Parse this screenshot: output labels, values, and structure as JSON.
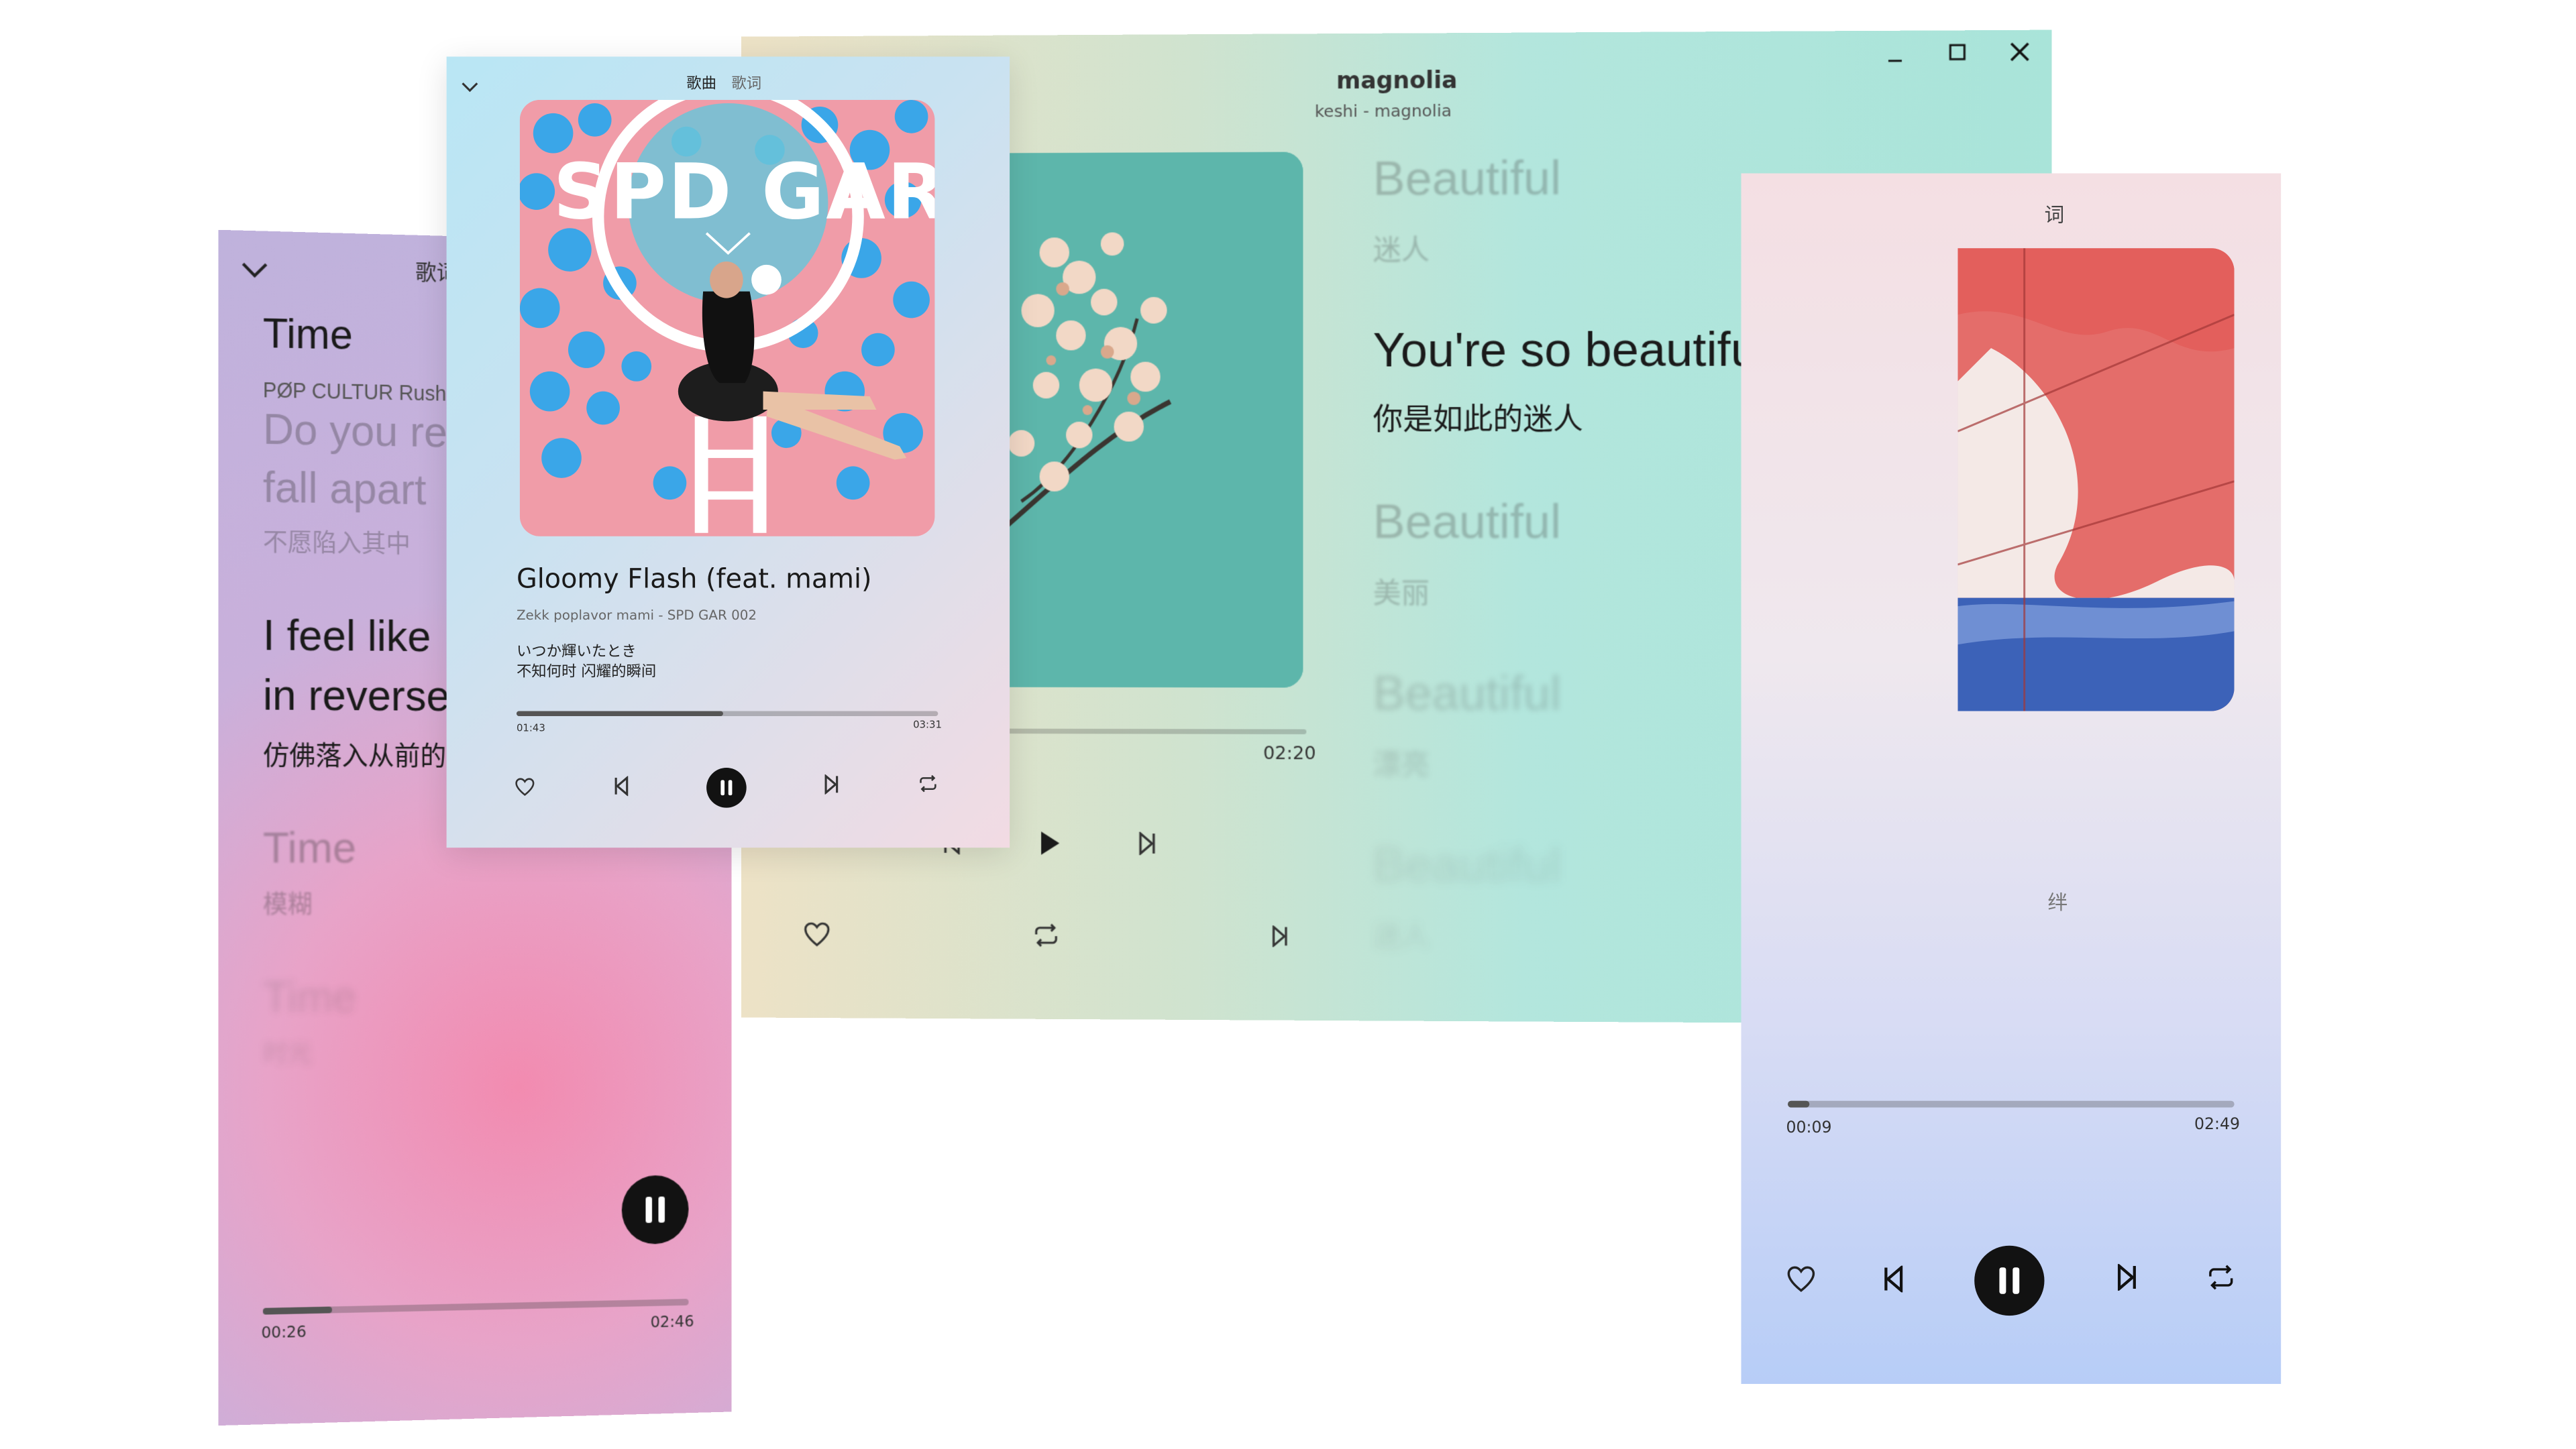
{
  "left": {
    "tab_label": "歌词",
    "title": "Time",
    "artist": "PØP CULTUR  Rush",
    "lyrics": [
      {
        "text": "Do you re"
      },
      {
        "text": "fall apart"
      },
      {
        "text": "不愿陷入其中"
      },
      {
        "text": "I feel like"
      },
      {
        "text": "in reverse"
      },
      {
        "text": "仿佛落入从前的"
      },
      {
        "text": "Time"
      },
      {
        "text": "模糊"
      },
      {
        "text": "Time"
      },
      {
        "text": "时光"
      }
    ],
    "elapsed": "00:26",
    "total": "02:46",
    "progress": 0.16
  },
  "center": {
    "title": "magnolia",
    "subtitle": "keshi  -  magnolia",
    "lyrics": [
      {
        "en": "Beautiful",
        "zh": "迷人"
      },
      {
        "en": "You're so beautiful",
        "zh": "你是如此的迷人"
      },
      {
        "en": "Beautiful",
        "zh": "美丽"
      },
      {
        "en": "Beautiful",
        "zh": "漂亮"
      },
      {
        "en": "Beautiful",
        "zh": "迷人"
      }
    ],
    "total": "02:20"
  },
  "right": {
    "tab_label": "词",
    "lyric_fragment": "绊",
    "elapsed": "00:09",
    "total": "02:49",
    "progress": 0.05
  },
  "front": {
    "tab_song": "歌曲",
    "tab_lyrics": "歌词",
    "album_text": "SPD GAR",
    "title": "Gloomy Flash (feat. mami)",
    "subtitle": "Zekk  poplavor  mami   -   SPD GAR 002",
    "lyric_jp": "いつか輝いたとき",
    "lyric_zh": "不知何时 闪耀的瞬间",
    "elapsed": "01:43",
    "total": "03:31",
    "progress": 0.49
  },
  "icons": {
    "heart": "heart-icon",
    "prev": "skip-previous-icon",
    "next": "skip-next-icon",
    "pause": "pause-icon",
    "play": "play-icon",
    "repeat": "repeat-icon",
    "chevron": "chevron-down-icon",
    "minimize": "minimize-icon",
    "maximize": "maximize-icon",
    "close": "close-icon"
  }
}
